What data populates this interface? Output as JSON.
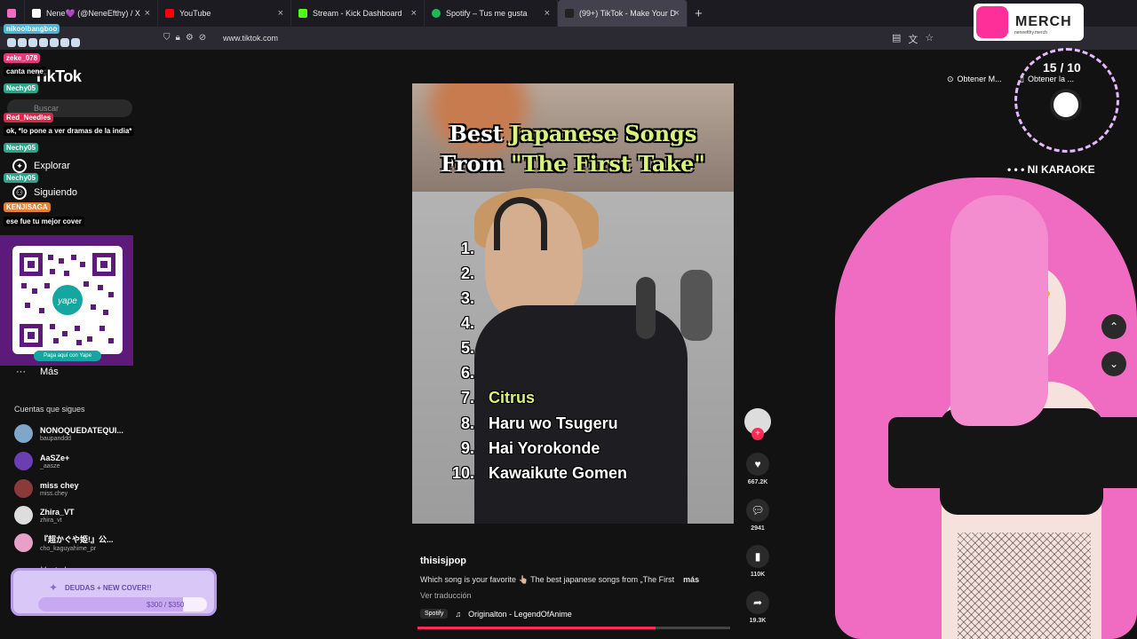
{
  "browser": {
    "tabs": [
      {
        "label": "Nene💜 (@NeneEfthy) / X",
        "color": "#ffffff"
      },
      {
        "label": "YouTube",
        "color": "#ff0000"
      },
      {
        "label": "Stream - Kick Dashboard",
        "color": "#53fc18"
      },
      {
        "label": "Spotify – Tus me gusta",
        "color": "#1db954"
      },
      {
        "label": "(99+) TikTok - Make Your D",
        "color": "#ffffff"
      }
    ],
    "new_tab": "+",
    "url": "www.tiktok.com"
  },
  "sidebar": {
    "logo": "TikTok",
    "search_placeholder": "Buscar",
    "nav": [
      {
        "label": "Explorar",
        "icon": "compass-icon"
      },
      {
        "label": "Siguiendo",
        "icon": "following-icon"
      }
    ],
    "qr_caption": "Paga aquí con Yape",
    "more": "Más",
    "following_title": "Cuentas que sigues",
    "following": [
      {
        "name": "NONOQUEDATEQUI...",
        "handle": "baupanddd",
        "color": "#7fa7c9"
      },
      {
        "name": "AaSZe+",
        "handle": "_aasze",
        "color": "#6b3fb2"
      },
      {
        "name": "miss chey",
        "handle": "miss.chey",
        "color": "#8a3a3a"
      },
      {
        "name": "Zhira_VT",
        "handle": "zhira_vt",
        "color": "#dddddd"
      },
      {
        "name": "『超かぐや姫!』公...",
        "handle": "cho_kaguyahime_pr",
        "color": "#e7a0c8"
      }
    ],
    "see_all": "Ver todo"
  },
  "chat": [
    {
      "user": "nikoolbangboo",
      "color": "#4db6d6",
      "msg": ""
    },
    {
      "user": "zeke_078",
      "color": "#e23a7a",
      "msg": "canta nene"
    },
    {
      "user": "Nechy05",
      "color": "#2ea38a",
      "msg": ""
    },
    {
      "user": "Red_Needles",
      "color": "#d6284a",
      "msg": "ok, *lo pone a ver dramas de la india*"
    },
    {
      "user": "Nechy05",
      "color": "#2ea38a",
      "msg": ""
    },
    {
      "user": "Nechy05",
      "color": "#2ea38a",
      "msg": ""
    },
    {
      "user": "KENJISAGA",
      "color": "#e0813a",
      "msg": "ese fue tu mejor cover"
    }
  ],
  "video": {
    "title_line1_a": "Best ",
    "title_line1_b": "Japanese Songs",
    "title_line2_a": "From ",
    "title_line2_b": "\"The First Take\"",
    "list": [
      {
        "num": "1.",
        "song": ""
      },
      {
        "num": "2.",
        "song": ""
      },
      {
        "num": "3.",
        "song": ""
      },
      {
        "num": "4.",
        "song": ""
      },
      {
        "num": "5.",
        "song": ""
      },
      {
        "num": "6.",
        "song": ""
      },
      {
        "num": "7.",
        "song": "Citrus"
      },
      {
        "num": "8.",
        "song": "Haru wo Tsugeru"
      },
      {
        "num": "9.",
        "song": "Hai Yorokonde"
      },
      {
        "num": "10.",
        "song": "Kawaikute Gomen"
      }
    ],
    "author": "thisisjpop",
    "caption": "Which song is your favorite 👆🏼 The best japanese songs from „The First",
    "caption_more": "más",
    "translate": "Ver traducción",
    "spotify": "Spotify",
    "music": "Originalton - LegendOfAnime",
    "progress": 0.76,
    "likes": "667.2K",
    "comments": "2941",
    "saves": "110K",
    "shares": "19.3K"
  },
  "overlay": {
    "merch": "MERCH",
    "merch_sub": "neneefthy.merch",
    "obtener1": "Obtener M...",
    "obtener2": "Obtener la ...",
    "counter": "15 / 10",
    "karaoke": "• • • NI KARAOKE",
    "goal_title": "DEUDAS + NEW COVER!!",
    "goal_value": "$300 / $350",
    "goal_progress": 0.857
  }
}
